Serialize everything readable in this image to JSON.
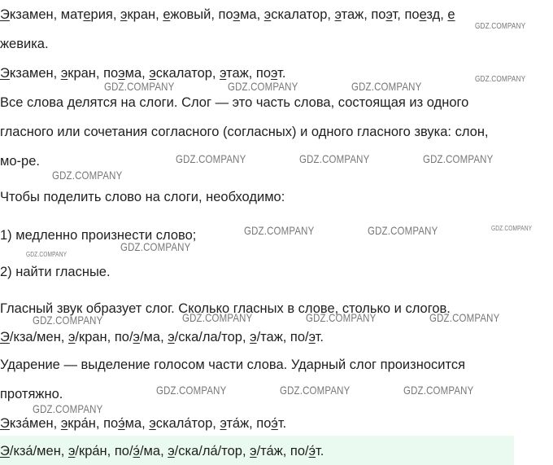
{
  "lines": [
    [
      {
        "t": "Э",
        "u": true
      },
      {
        "t": "кзамен, мат"
      },
      {
        "t": "е",
        "u": true
      },
      {
        "t": "рия, "
      },
      {
        "t": "э",
        "u": true
      },
      {
        "t": "кран, "
      },
      {
        "t": "е",
        "u": true
      },
      {
        "t": "жовый, по"
      },
      {
        "t": "э",
        "u": true
      },
      {
        "t": "ма, "
      },
      {
        "t": "э",
        "u": true
      },
      {
        "t": "скалатор, "
      },
      {
        "t": "э",
        "u": true
      },
      {
        "t": "таж, по"
      },
      {
        "t": "э",
        "u": true
      },
      {
        "t": "т, по"
      },
      {
        "t": "е",
        "u": true
      },
      {
        "t": "зд, "
      },
      {
        "t": "е",
        "u": true
      }
    ],
    [
      {
        "t": "жевика."
      }
    ],
    [
      {
        "t": "Э",
        "u": true
      },
      {
        "t": "кзамен, "
      },
      {
        "t": "э",
        "u": true
      },
      {
        "t": "кран, по"
      },
      {
        "t": "э",
        "u": true
      },
      {
        "t": "ма, "
      },
      {
        "t": "э",
        "u": true
      },
      {
        "t": "скалатор, "
      },
      {
        "t": "э",
        "u": true
      },
      {
        "t": "таж, по"
      },
      {
        "t": "э",
        "u": true
      },
      {
        "t": "т."
      }
    ],
    [
      {
        "t": "Все слова делятся на слоги. Слог — это часть слова, состоящая из одного"
      }
    ],
    [
      {
        "t": "гласного или сочетания согласного (согласных) и одного гласного звука: слон,"
      }
    ],
    [
      {
        "t": "мо-ре."
      }
    ],
    [
      {
        "t": "Чтобы поделить слово на слоги, необходимо:"
      }
    ],
    [
      {
        "t": "1) медленно произнести слово;"
      }
    ],
    [
      {
        "t": "2) найти гласные."
      }
    ],
    [
      {
        "t": "Гласный звук образует слог. Сколько гласных в слове, столько и слогов."
      }
    ],
    [
      {
        "t": "Э",
        "u": true
      },
      {
        "t": "/кза/мен, "
      },
      {
        "t": "э",
        "u": true
      },
      {
        "t": "/кран, по/"
      },
      {
        "t": "э",
        "u": true
      },
      {
        "t": "/ма, "
      },
      {
        "t": "э",
        "u": true
      },
      {
        "t": "/ска/ла/тор, "
      },
      {
        "t": "э",
        "u": true
      },
      {
        "t": "/таж, по/"
      },
      {
        "t": "э",
        "u": true
      },
      {
        "t": "т."
      }
    ],
    [
      {
        "t": "Ударение — выделение голосом части слова. Ударный слог произносится"
      }
    ],
    [
      {
        "t": "протяжно."
      }
    ],
    [
      {
        "t": "Э",
        "u": true
      },
      {
        "t": "кза́мен, "
      },
      {
        "t": "э",
        "u": true
      },
      {
        "t": "кра́н, по"
      },
      {
        "t": "э́",
        "u": true
      },
      {
        "t": "ма, "
      },
      {
        "t": "э",
        "u": true
      },
      {
        "t": "скала́тор, "
      },
      {
        "t": "э",
        "u": true
      },
      {
        "t": "та́ж, по"
      },
      {
        "t": "э́",
        "u": true
      },
      {
        "t": "т."
      }
    ],
    [
      {
        "t": "Э",
        "u": true
      },
      {
        "t": "/кза́/мен, "
      },
      {
        "t": "э",
        "u": true
      },
      {
        "t": "/кра́н, по/"
      },
      {
        "t": "э́",
        "u": true
      },
      {
        "t": "/ма, "
      },
      {
        "t": "э",
        "u": true
      },
      {
        "t": "/ска/ла́/тор, "
      },
      {
        "t": "э",
        "u": true
      },
      {
        "t": "/та́ж, по/"
      },
      {
        "t": "э́",
        "u": true
      },
      {
        "t": "т."
      }
    ]
  ],
  "watermark": "GDZ.COMPANY",
  "colors": {
    "text": "#1f1f1f",
    "watermark": "#777777",
    "highlight": "#eafaf0"
  }
}
